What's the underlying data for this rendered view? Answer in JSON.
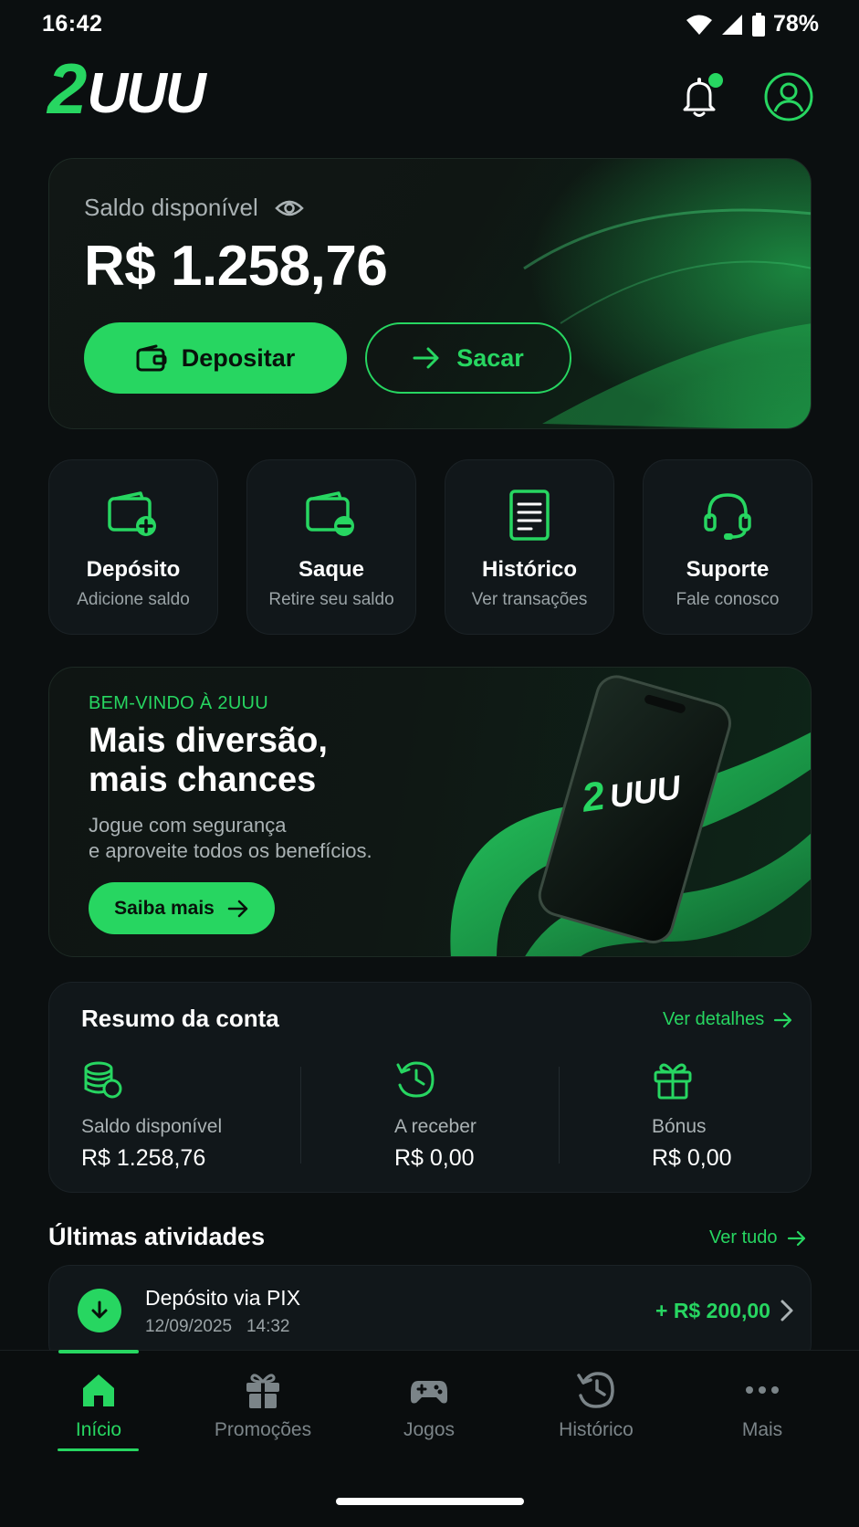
{
  "status_bar": {
    "time": "16:42",
    "battery": "78%"
  },
  "header": {
    "logo_prefix": "2",
    "logo_suffix": "UUU",
    "icons": [
      "bell-icon",
      "profile-icon"
    ]
  },
  "balance": {
    "label": "Saldo disponível",
    "amount": "R$ 1.258,76",
    "deposit_label": "Depositar",
    "withdraw_label": "Sacar"
  },
  "quick_actions": [
    {
      "title": "Depósito",
      "subtitle": "Adicione saldo",
      "icon": "wallet-plus-icon"
    },
    {
      "title": "Saque",
      "subtitle": "Retire seu saldo",
      "icon": "wallet-minus-icon"
    },
    {
      "title": "Histórico",
      "subtitle": "Ver transações",
      "icon": "document-icon"
    },
    {
      "title": "Suporte",
      "subtitle": "Fale conosco",
      "icon": "headset-icon"
    }
  ],
  "promo": {
    "kicker": "BEM-VINDO À 2UUU",
    "title_line1": "Mais diversão,",
    "title_line2": "mais chances",
    "sub_line1": "Jogue com segurança",
    "sub_line2": "e aproveite todos os benefícios.",
    "button": "Saiba mais",
    "phone_logo_prefix": "2",
    "phone_logo_suffix": "UUU"
  },
  "summary": {
    "title": "Resumo da conta",
    "link": "Ver detalhes",
    "items": [
      {
        "label": "Saldo disponível",
        "value": "R$ 1.258,76",
        "icon": "coins-icon"
      },
      {
        "label": "A receber",
        "value": "R$ 0,00",
        "icon": "clock-history-icon"
      },
      {
        "label": "Bónus",
        "value": "R$ 0,00",
        "icon": "gift-icon"
      }
    ]
  },
  "activities": {
    "title": "Últimas atividades",
    "link": "Ver tudo",
    "items": [
      {
        "name": "Depósito via PIX",
        "date": "12/09/2025",
        "time": "14:32",
        "amount": "+ R$ 200,00"
      }
    ]
  },
  "nav": {
    "items": [
      {
        "label": "Início",
        "icon": "home-icon",
        "active": true
      },
      {
        "label": "Promoções",
        "icon": "gift-icon",
        "active": false
      },
      {
        "label": "Jogos",
        "icon": "gamepad-icon",
        "active": false
      },
      {
        "label": "Histórico",
        "icon": "history-icon",
        "active": false
      },
      {
        "label": "Mais",
        "icon": "more-icon",
        "active": false
      }
    ]
  },
  "colors": {
    "accent": "#27d661",
    "background": "#0b0f10",
    "card": "#11171a"
  }
}
